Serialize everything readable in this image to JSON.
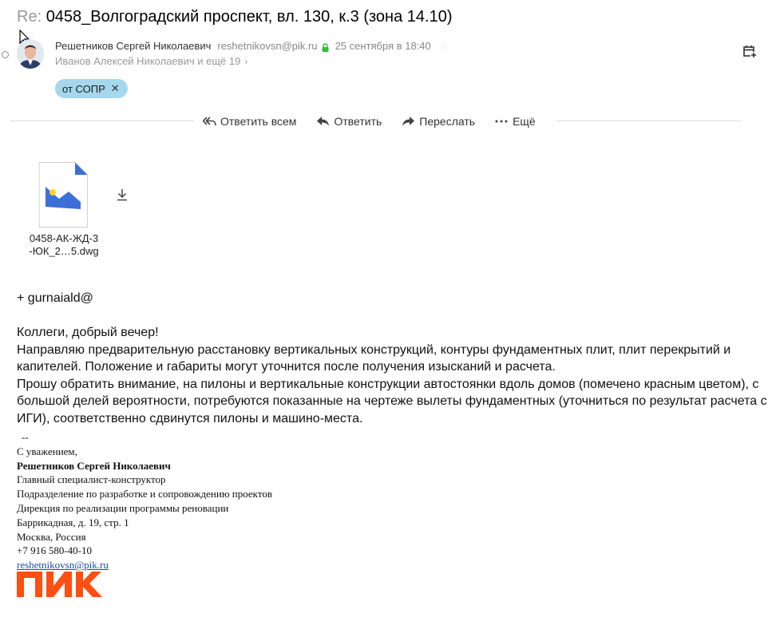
{
  "subject": {
    "prefix": "Re:",
    "title": "0458_Волгоградский проспект, вл. 130, к.3 (зона 14.10)"
  },
  "sender": {
    "name": "Решетников Сергей Николаевич",
    "email": "reshetnikovsn@pik.ru",
    "date": "25 сентября в 18:40",
    "recipients": "Иванов Алексей Николаевич и ещё 19"
  },
  "label": {
    "text": "от СОПР",
    "remove": "✕"
  },
  "actions": {
    "reply_all": "Ответить всем",
    "reply": "Ответить",
    "forward": "Переслать",
    "more": "Ещё"
  },
  "attachment": {
    "name_line1": "0458-АК-ЖД-3",
    "name_line2": "-ЮК_2…5.dwg"
  },
  "body": {
    "plus": "+ gurnaiald@",
    "greeting": "Коллеги, добрый вечер!",
    "para1": "Направляю предварительную расстановку вертикальных конструкций, контуры фундаментных плит, плит перекрытий и капителей. Положение и габариты могут уточнится после получения изысканий и расчета.",
    "para2": "Прошу обратить внимание, на пилоны и вертикальные конструкции автостоянки вдоль домов (помечено красным цветом), с большой делей вероятности, потребуются показанные на чертеже вылеты фундаментных (уточниться по результат расчета с ИГИ), соответственно сдвинутся пилоны и машино-места."
  },
  "signature": {
    "dash": "--",
    "regards": "С уважением,",
    "name": "Решетников Сергей Николаевич",
    "position": "Главный специалист-конструктор",
    "department": "Подразделение по разработке и сопровождению проектов",
    "directorate": "Дирекция по реализации программы реновации",
    "address": "Баррикадная, д. 19, стр. 1",
    "city": "Москва, Россия",
    "phone": "+7 916 580-40-10",
    "email": "reshetnikovsn@pik.ru",
    "logo_text": "ПИК"
  },
  "colors": {
    "chip_bg": "#a5d8ec",
    "pik_orange": "#ff4f12",
    "link": "#1a4ea8",
    "lock_green": "#2dbe3c",
    "file_blue": "#3d6fd9"
  },
  "icons": [
    "cursor-icon",
    "avatar",
    "lock-icon",
    "star-icon",
    "chevron-right-icon",
    "calendar-add-icon",
    "reply-all-icon",
    "reply-icon",
    "forward-icon",
    "more-icon",
    "image-file-icon",
    "download-icon",
    "close-icon"
  ]
}
